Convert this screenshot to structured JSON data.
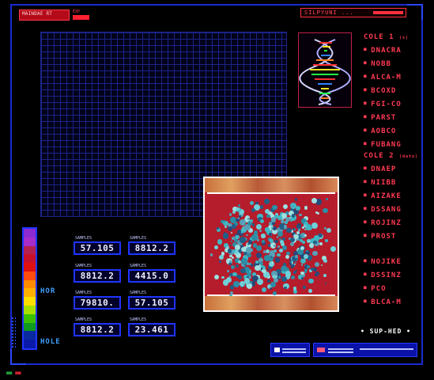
{
  "header": {
    "logo_text": "MAINDAE RT",
    "logo_small": "EXP",
    "title": "SILPYUNI ..."
  },
  "dna_caption": "",
  "side_panel": {
    "group1_head": "COLE 1",
    "group1_head_suffix": "(s)",
    "group1": [
      "DNACRA",
      "NOBB",
      "ALCA-M",
      "BCOXD",
      "FGI-CO",
      "PARST",
      "AOBCO",
      "FUBANG"
    ],
    "group2_head": "COLE 2",
    "group2_head_suffix": "(dato)",
    "group2": [
      "DNAEP",
      "NIIBB",
      "AIZAKE",
      "DSSANG",
      "ROJINZ",
      "PROST"
    ],
    "group3": [
      "NOJIKE",
      "DSSINZ",
      "PCO",
      "BLCA-M"
    ]
  },
  "scale": {
    "label_high": "HOR",
    "label_low": "HOLE",
    "colors": [
      "#8b2bd0",
      "#a82cc8",
      "#b52050",
      "#c8102a",
      "#e01010",
      "#ff4a10",
      "#ff8a00",
      "#ffb000",
      "#ffe000",
      "#a8e000",
      "#3cc000",
      "#109a20",
      "#0a2aa0",
      "#0a1aa8"
    ]
  },
  "values": [
    {
      "caption": "SAMPLES",
      "value": "57.105"
    },
    {
      "caption": "SAMPLES",
      "value": "8812.2"
    },
    {
      "caption": "SAMPLES",
      "value": "8812.2"
    },
    {
      "caption": "SAMPLES",
      "value": "4415.0"
    },
    {
      "caption": "SAMPLES",
      "value": "79810."
    },
    {
      "caption": "SAMPLES",
      "value": "57.105"
    },
    {
      "caption": "SAMPLES",
      "value": "8812.2"
    },
    {
      "caption": "SAMPLES",
      "value": "23.461"
    }
  ],
  "footer": {
    "support": "• SUP-HED •",
    "legend1": "",
    "legend2": "",
    "legend1_color": "#ffffff",
    "legend2_color": "#ff5a7a"
  },
  "colors": {
    "accent_red": "#ff3850",
    "accent_blue": "#1f34ff",
    "background": "#000000"
  }
}
